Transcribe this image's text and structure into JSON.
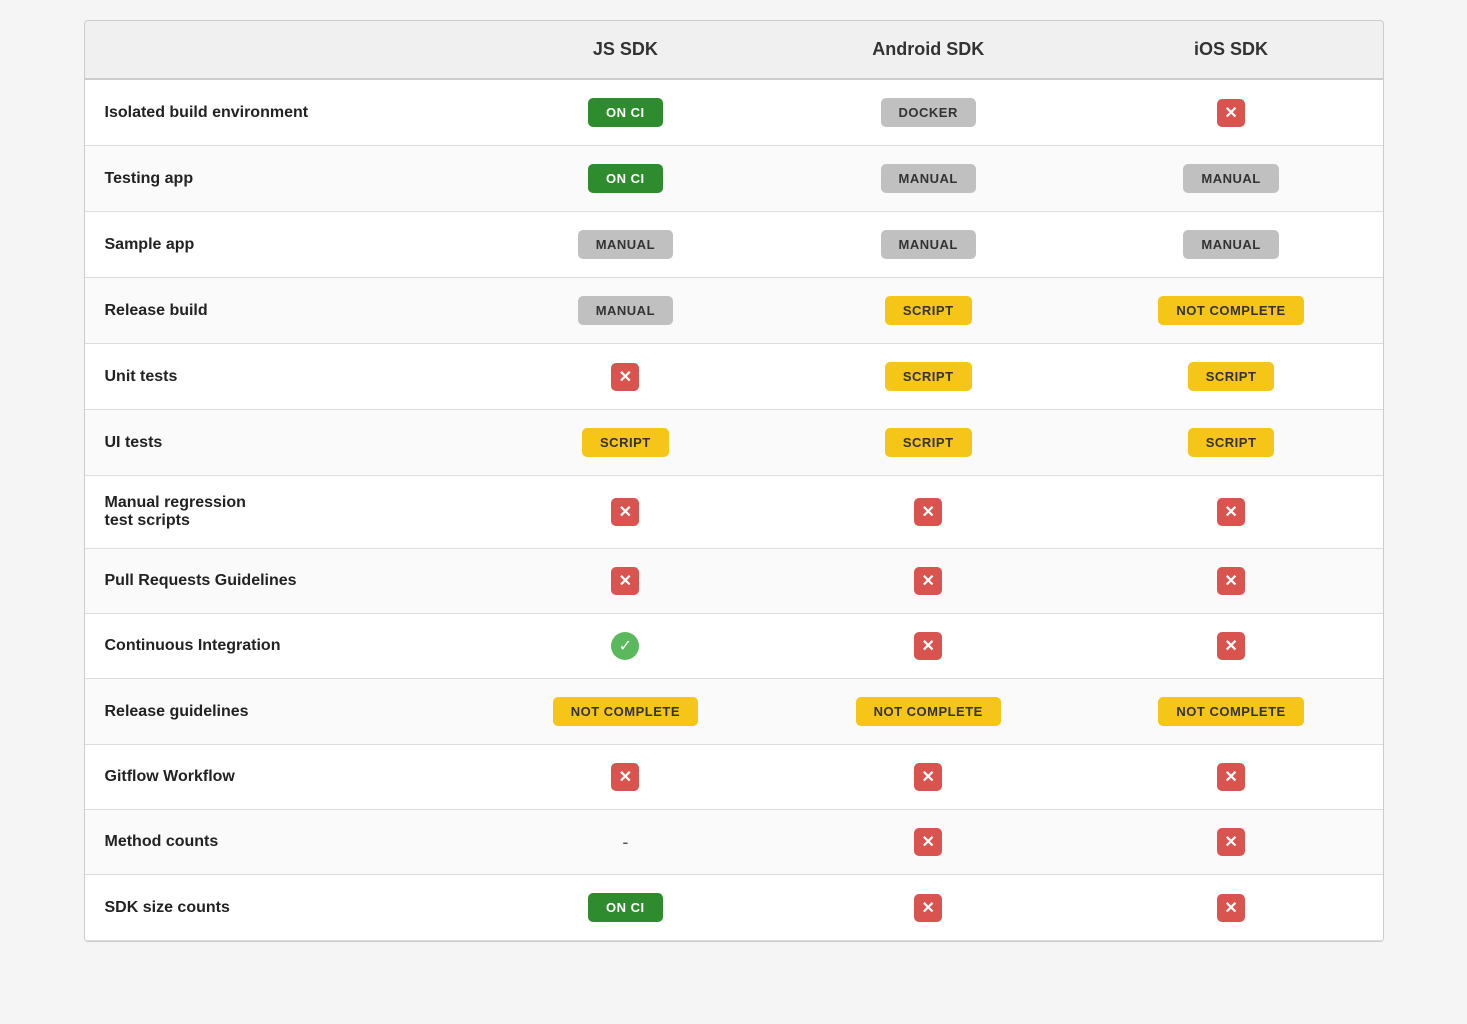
{
  "columns": [
    "",
    "JS SDK",
    "Android SDK",
    "iOS SDK"
  ],
  "rows": [
    {
      "label": "Isolated build environment",
      "js": {
        "type": "badge-green",
        "text": "ON CI"
      },
      "android": {
        "type": "badge-gray",
        "text": "DOCKER"
      },
      "ios": {
        "type": "icon-x"
      }
    },
    {
      "label": "Testing app",
      "js": {
        "type": "badge-green",
        "text": "ON CI"
      },
      "android": {
        "type": "badge-gray",
        "text": "MANUAL"
      },
      "ios": {
        "type": "badge-gray",
        "text": "MANUAL"
      }
    },
    {
      "label": "Sample app",
      "js": {
        "type": "badge-gray",
        "text": "MANUAL"
      },
      "android": {
        "type": "badge-gray",
        "text": "MANUAL"
      },
      "ios": {
        "type": "badge-gray",
        "text": "MANUAL"
      }
    },
    {
      "label": "Release build",
      "js": {
        "type": "badge-gray",
        "text": "MANUAL"
      },
      "android": {
        "type": "badge-yellow",
        "text": "SCRIPT"
      },
      "ios": {
        "type": "badge-yellow",
        "text": "NOT COMPLETE"
      }
    },
    {
      "label": "Unit tests",
      "js": {
        "type": "icon-x"
      },
      "android": {
        "type": "badge-yellow",
        "text": "SCRIPT"
      },
      "ios": {
        "type": "badge-yellow",
        "text": "SCRIPT"
      }
    },
    {
      "label": "UI tests",
      "js": {
        "type": "badge-yellow",
        "text": "SCRIPT"
      },
      "android": {
        "type": "badge-yellow",
        "text": "SCRIPT"
      },
      "ios": {
        "type": "badge-yellow",
        "text": "SCRIPT"
      }
    },
    {
      "label": "Manual regression\ntest scripts",
      "js": {
        "type": "icon-x"
      },
      "android": {
        "type": "icon-x"
      },
      "ios": {
        "type": "icon-x"
      }
    },
    {
      "label": "Pull Requests Guidelines",
      "js": {
        "type": "icon-x"
      },
      "android": {
        "type": "icon-x"
      },
      "ios": {
        "type": "icon-x"
      }
    },
    {
      "label": "Continuous Integration",
      "js": {
        "type": "icon-check"
      },
      "android": {
        "type": "icon-x"
      },
      "ios": {
        "type": "icon-x"
      }
    },
    {
      "label": "Release guidelines",
      "js": {
        "type": "badge-yellow",
        "text": "NOT COMPLETE"
      },
      "android": {
        "type": "badge-yellow",
        "text": "NOT COMPLETE"
      },
      "ios": {
        "type": "badge-yellow",
        "text": "NOT COMPLETE"
      }
    },
    {
      "label": "Gitflow Workflow",
      "js": {
        "type": "icon-x"
      },
      "android": {
        "type": "icon-x"
      },
      "ios": {
        "type": "icon-x"
      }
    },
    {
      "label": "Method counts",
      "js": {
        "type": "dash",
        "text": "-"
      },
      "android": {
        "type": "icon-x"
      },
      "ios": {
        "type": "icon-x"
      }
    },
    {
      "label": "SDK size counts",
      "js": {
        "type": "badge-green",
        "text": "ON CI"
      },
      "android": {
        "type": "icon-x"
      },
      "ios": {
        "type": "icon-x"
      }
    }
  ]
}
